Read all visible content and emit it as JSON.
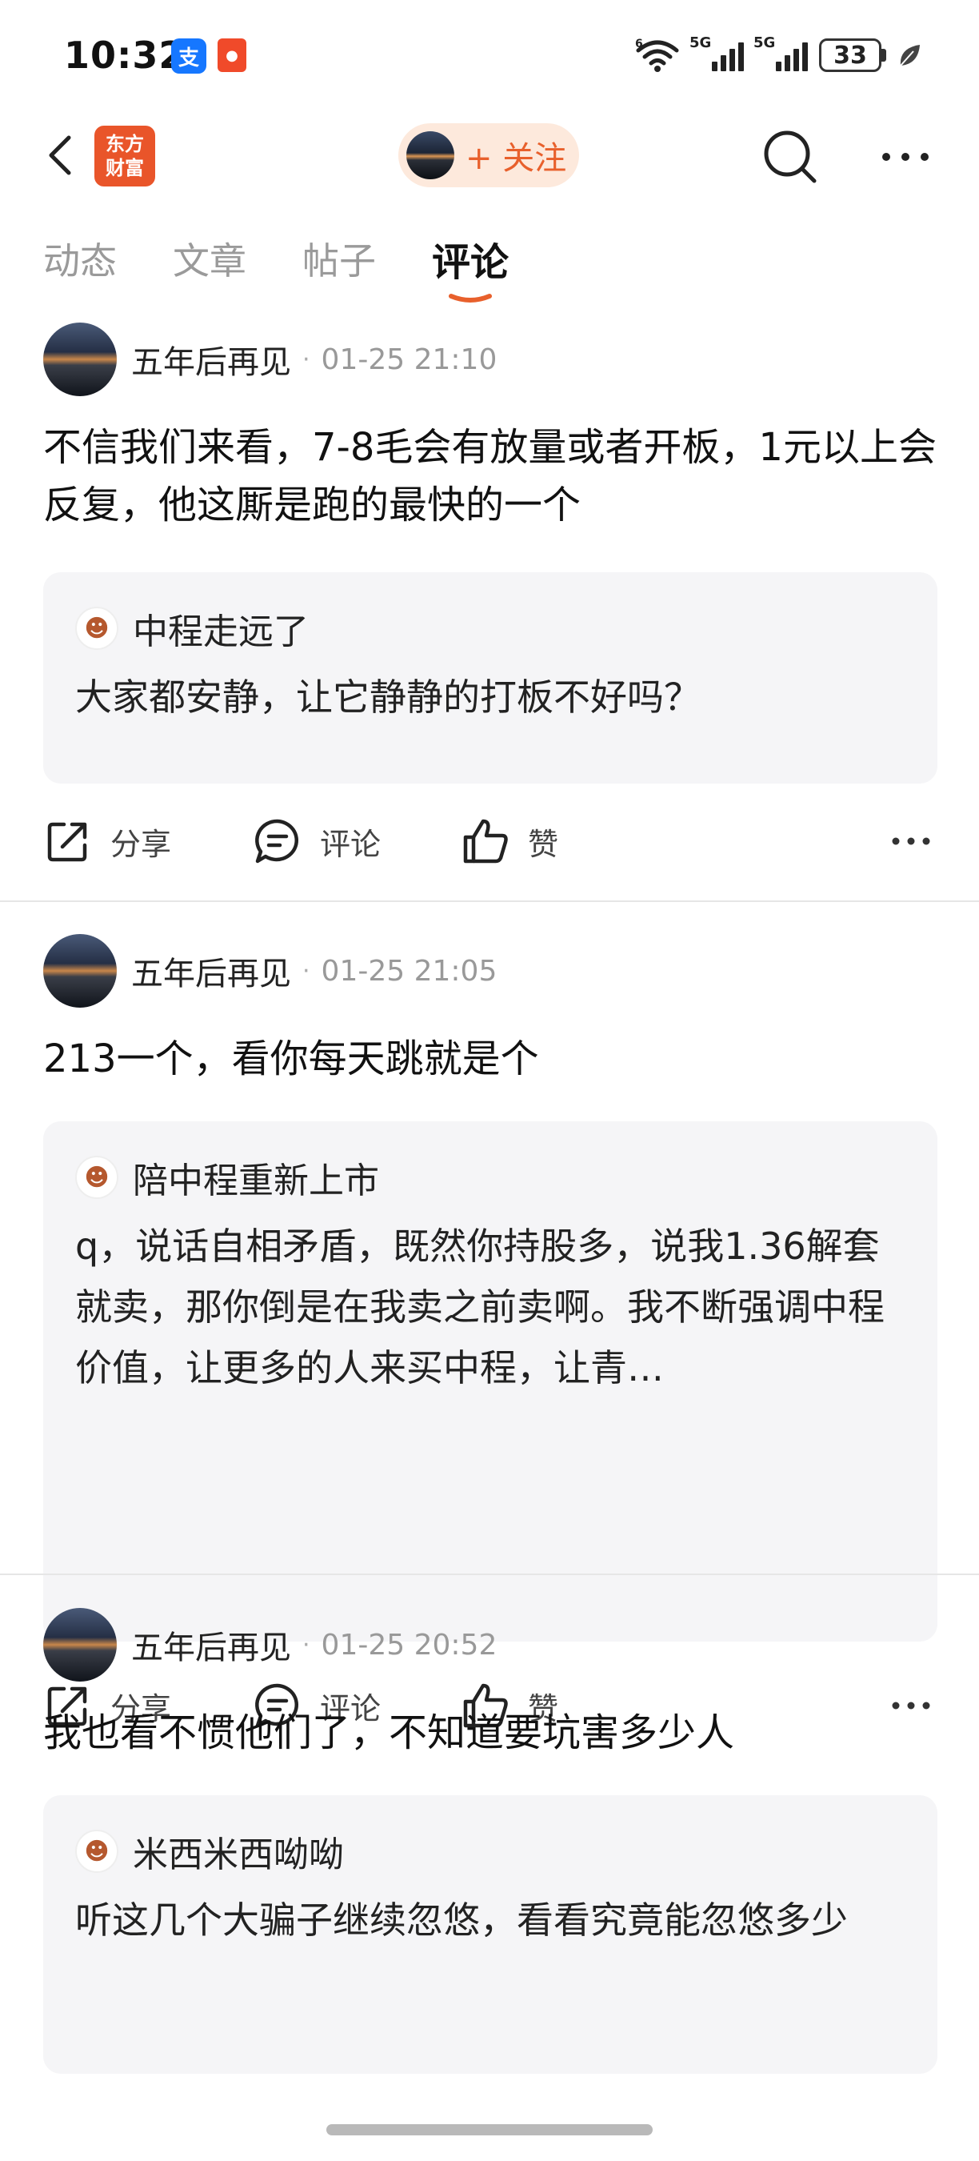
{
  "status_bar": {
    "time": "10:32",
    "alipay_icon": "支",
    "notification_icon": "●",
    "signal_1_label": "5G",
    "signal_2_label": "5G",
    "wifi_label": "6",
    "battery": "33"
  },
  "nav": {
    "brand_line1": "东方",
    "brand_line2": "财富",
    "follow_label": "+ 关注"
  },
  "tabs": [
    {
      "label": "动态"
    },
    {
      "label": "文章"
    },
    {
      "label": "帖子"
    },
    {
      "label": "评论",
      "active": true
    }
  ],
  "posts": [
    {
      "author": "五年后再见",
      "time": "01-25 21:10",
      "text": "不信我们来看，7-8毛会有放量或者开板，1元以上会反复，他这厮是跑的最快的一个",
      "quote": {
        "author": "中程走远了",
        "text": "大家都安静，让它静静的打板不好吗？"
      }
    },
    {
      "author": "五年后再见",
      "time": "01-25 21:05",
      "text": "213一个，看你每天跳就是个",
      "quote": {
        "author": "陪中程重新上市",
        "text": "q，说话自相矛盾，既然你持股多，说我1.36解套就卖，那你倒是在我卖之前卖啊。我不断强调中程价值，让更多的人来买中程，让青…"
      }
    },
    {
      "author": "五年后再见",
      "time": "01-25 20:52",
      "text": "我也看不惯他们了，不知道要坑害多少人",
      "quote": {
        "author": "米西米西呦呦",
        "text": "听这几个大骗子继续忽悠，看看究竟能忽悠多少"
      }
    }
  ],
  "actions": {
    "share": "分享",
    "comment": "评论",
    "like": "赞"
  },
  "colors": {
    "accent": "#e8602c",
    "follow_bg": "#fde9dc",
    "quote_bg": "#f5f5f7"
  }
}
